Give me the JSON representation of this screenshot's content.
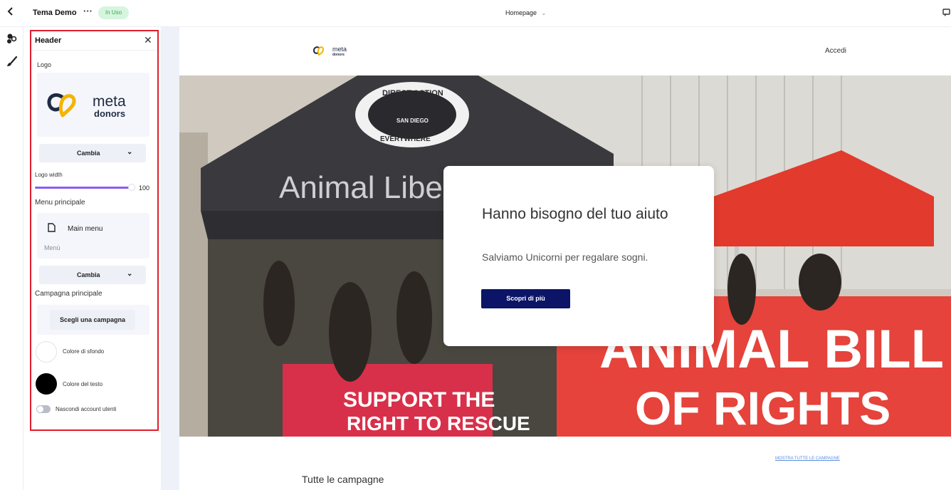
{
  "topbar": {
    "back_icon": "chevron-left-icon",
    "theme_name": "Tema Demo",
    "more_label": "···",
    "status_badge": "In Uso",
    "page_select": "Homepage",
    "page_select_icon": "chevron-down-icon",
    "corner_icon": "chat-icon"
  },
  "rail": {
    "items": [
      {
        "icon": "sections-icon",
        "active": true
      },
      {
        "icon": "brush-icon",
        "active": false
      }
    ]
  },
  "panel": {
    "title": "Header",
    "close_icon": "close-icon",
    "logo_label": "Logo",
    "logo": {
      "brand_top": "meta",
      "brand_bottom": "donors",
      "heart_colors": [
        "#1f2a44",
        "#f5b400"
      ]
    },
    "change_logo_label": "Cambia",
    "logo_width_label": "Logo width",
    "logo_width_value": "100",
    "logo_width_fraction": 1.0,
    "main_menu_label": "Menu principale",
    "main_menu_name": "Main menu",
    "main_menu_type": "Menù",
    "change_menu_label": "Cambia",
    "main_campaign_label": "Campagna principale",
    "pick_campaign_label": "Scegli una campagna",
    "bg_color_label": "Colore di sfondo",
    "bg_color": "#ffffff",
    "text_color_label": "Colore del testo",
    "text_color": "#000000",
    "hide_accounts_label": "Nascondi account utenti",
    "hide_accounts_on": false,
    "highlight_color": "#e11d2b",
    "slider_color": "#8b5cf6"
  },
  "preview": {
    "header_logo": {
      "brand_top": "meta",
      "brand_bottom": "donors"
    },
    "login_label": "Accedi",
    "hero": {
      "title": "Hanno bisogno del tuo aiuto",
      "subtitle": "Salviamo Unicorni per regalare sogni.",
      "button_label": "Scopri di più",
      "button_color": "#0b1466",
      "tent_texts": [
        "DIRECT ACTION",
        "SAN DIEGO",
        "EVERYWHERE",
        "Animal Libe"
      ],
      "banner_texts": [
        "ANIMAL BILL",
        "OF RIGHTS",
        "SUPPORT THE",
        "RIGHT TO RESCUE"
      ]
    },
    "all_campaigns_link": "MOSTRA TUTTE LE CAMPAGNE",
    "all_campaigns_title": "Tutte le campagne"
  }
}
